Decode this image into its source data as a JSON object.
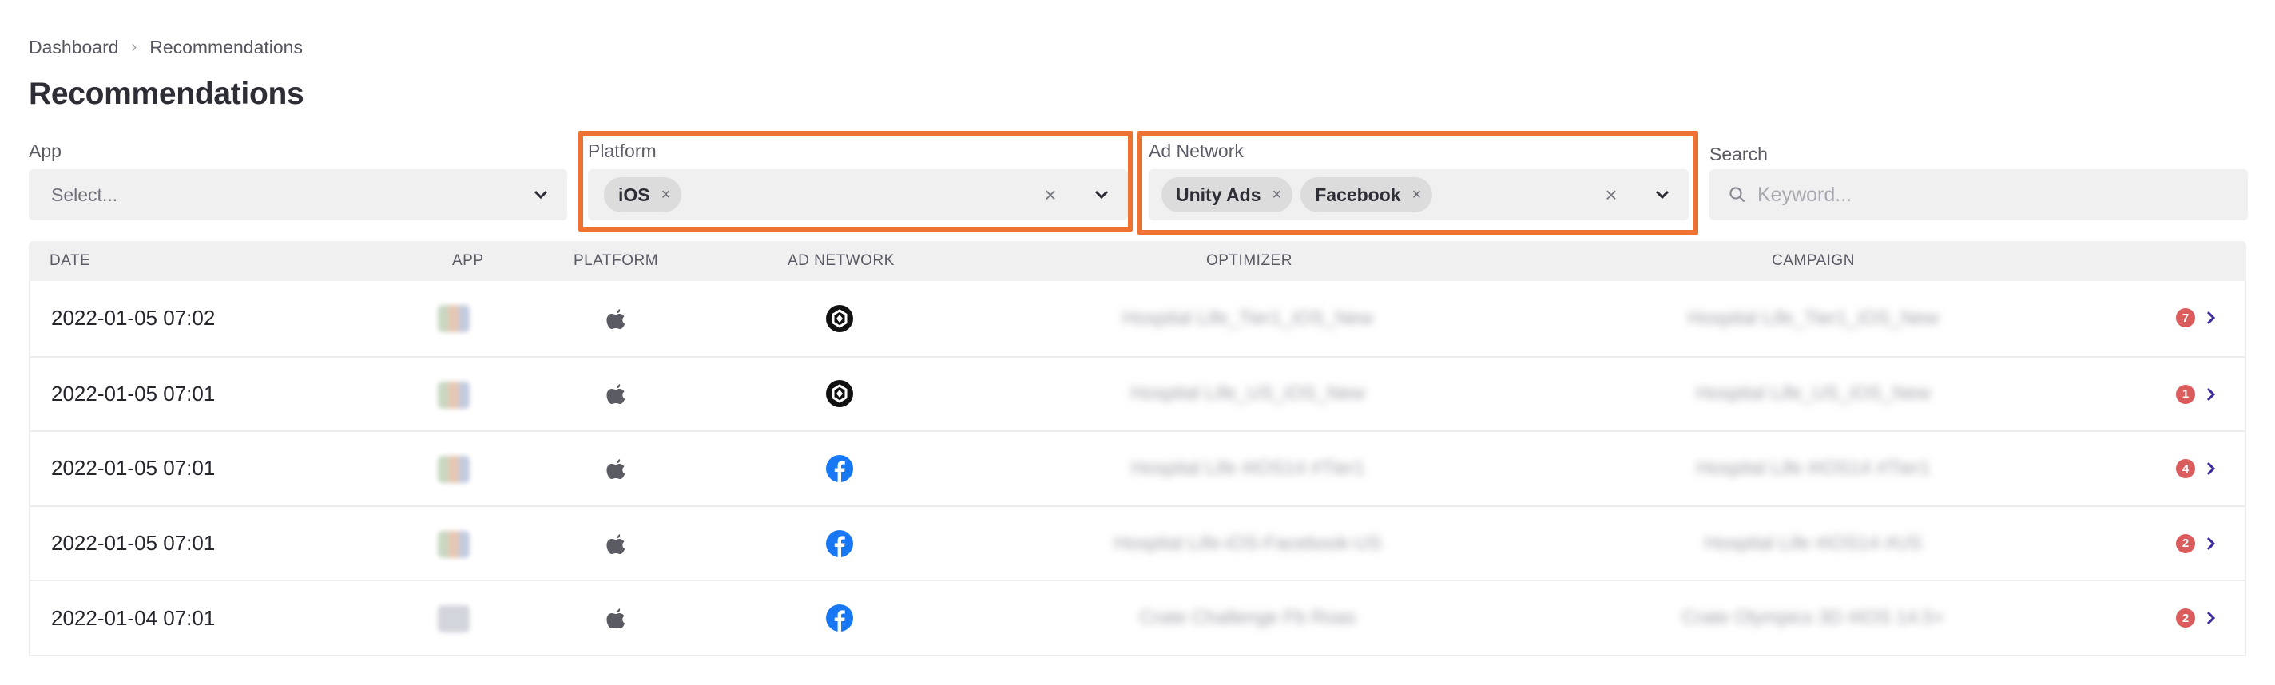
{
  "breadcrumb": [
    {
      "label": "Dashboard"
    },
    {
      "label": "Recommendations"
    }
  ],
  "breadcrumb_separator": "›",
  "page_title": "Recommendations",
  "filters": {
    "app": {
      "label": "App",
      "placeholder": "Select..."
    },
    "platform": {
      "label": "Platform",
      "selected": [
        {
          "label": "iOS",
          "remove": "×"
        }
      ],
      "clear": "×"
    },
    "ad_network": {
      "label": "Ad Network",
      "selected": [
        {
          "label": "Unity Ads",
          "remove": "×"
        },
        {
          "label": "Facebook",
          "remove": "×"
        }
      ],
      "clear": "×"
    },
    "search": {
      "label": "Search",
      "placeholder": "Keyword..."
    }
  },
  "highlight_color": "#ee7232",
  "table": {
    "columns": [
      "DATE",
      "APP",
      "PLATFORM",
      "AD NETWORK",
      "OPTIMIZER",
      "CAMPAIGN"
    ],
    "rows": [
      {
        "date": "2022-01-05 07:02",
        "platform_icon": "apple-icon",
        "network_icon": "unity-ads-icon",
        "optimizer": "Hospital Life_Tier1_iOS_New",
        "campaign": "Hospital Life_Tier1_iOS_New",
        "count": "7"
      },
      {
        "date": "2022-01-05 07:01",
        "platform_icon": "apple-icon",
        "network_icon": "unity-ads-icon",
        "optimizer": "Hospital Life_US_iOS_New",
        "campaign": "Hospital Life_US_iOS_New",
        "count": "1"
      },
      {
        "date": "2022-01-05 07:01",
        "platform_icon": "apple-icon",
        "network_icon": "facebook-icon",
        "optimizer": "Hospital Life #iOS14 #Tier1",
        "campaign": "Hospital Life #iOS14 #Tier1",
        "count": "4"
      },
      {
        "date": "2022-01-05 07:01",
        "platform_icon": "apple-icon",
        "network_icon": "facebook-icon",
        "optimizer": "Hospital Life-iOS-Facebook-US",
        "campaign": "Hospital Life #iOS14 #US",
        "count": "2"
      },
      {
        "date": "2022-01-04 07:01",
        "platform_icon": "apple-icon",
        "network_icon": "facebook-icon",
        "optimizer": "Crate Challenge Fb Roas",
        "campaign": "Crate Olympics 3D #iOS 14.5+",
        "count": "2"
      }
    ]
  },
  "colors": {
    "badge": "#db5c5c",
    "chevron": "#3d2a9e",
    "facebook": "#1877f2"
  }
}
